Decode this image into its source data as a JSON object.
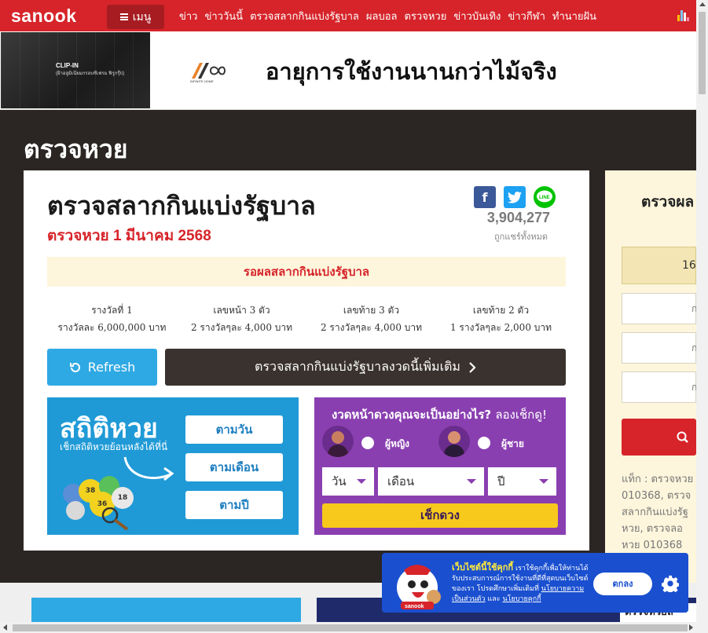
{
  "nav": {
    "logo": "sanook",
    "menu_label": "เมนู",
    "links": [
      "ข่าว",
      "ข่าววันนี้",
      "ตรวจสลากกินแบ่งรัฐบาล",
      "ผลบอล",
      "ตรวจหวย",
      "ข่าวบันเทิง",
      "ข่าวกีฬา",
      "ทำนายฝัน"
    ]
  },
  "ad": {
    "clip_title": "CLIP-IN",
    "clip_sub": "(ฝ้าอลูมิเนียมกรอบซีเฟรม ฟิรูกรุ๊ป)",
    "brand_word": "INFINITE HOME",
    "headline": "อายุการใช้งานนานกว่าไม้จริง"
  },
  "page": {
    "title": "ตรวจหวย"
  },
  "lottery": {
    "title": "ตรวจสลากกินแบ่งรัฐบาล",
    "date": "ตรวจหวย 1 มีนาคม 2568",
    "share_count": "3,904,277",
    "share_label": "ถูกแชร์ทั้งหมด",
    "waiting": "รอผลสลากกินแบ่งรัฐบาล",
    "prizes": [
      {
        "name": "รางวัลที่ 1",
        "detail": "รางวัลละ 6,000,000 บาท"
      },
      {
        "name": "เลขหน้า 3 ตัว",
        "detail": "2 รางวัลๆละ 4,000 บาท"
      },
      {
        "name": "เลขท้าย 3 ตัว",
        "detail": "2 รางวัลๆละ 4,000 บาท"
      },
      {
        "name": "เลขท้าย 2 ตัว",
        "detail": "1 รางวัลๆละ 2,000 บาท"
      }
    ],
    "refresh_label": "Refresh",
    "more_label": "ตรวจสลากกินแบ่งรัฐบาลงวดนี้เพิ่มเติม"
  },
  "stats": {
    "title": "สถิติหวย",
    "subtitle": "เช็กสถิติหวยย้อนหลังได้ที่นี่",
    "buttons": [
      "ตามวัน",
      "ตามเดือน",
      "ตามปี"
    ],
    "balls": [
      "38",
      "36",
      "18"
    ]
  },
  "horoscope": {
    "question": "งวดหน้าดวงคุณจะเป็นอย่างไร?",
    "cta": "ลองเช็กดู!",
    "female": "ผู้หญิง",
    "male": "ผู้ชาย",
    "day": "วัน",
    "month": "เดือน",
    "year": "ปี",
    "check_btn": "เช็กดวง"
  },
  "sidebar": {
    "title": "ตรวจผล",
    "date": "16",
    "input_hint": "ก",
    "tags": "แท็ก :  ตรวจหวย\n010368,  ตรวจ\nสลากกินแบ่งรัฐ\nหวย,  ตรวจลอ\nหวย 010368",
    "bottom_title": "ตรวจหวยล"
  },
  "cookie": {
    "heading": "เว็บไซต์นี้ใช้คุกกี้",
    "body": "เราใช้คุกกี้เพื่อให้ท่านได้รับประสบการณ์การใช้งานที่ดีที่สุดบนเว็บไซต์ของเรา โปรดศึกษาเพิ่มเติมที่",
    "privacy": "นโยบายความเป็นส่วนตัว",
    "and": "และ",
    "cookie_policy": "นโยบายคุกกี้",
    "ok": "ตกลง",
    "mascot_label": "sanook"
  },
  "colors": {
    "brand_red": "#d6242a",
    "dark_bg": "#2b2624",
    "blue": "#2fa9e3",
    "purple": "#8a3fb1",
    "cream": "#fdf6dc"
  }
}
